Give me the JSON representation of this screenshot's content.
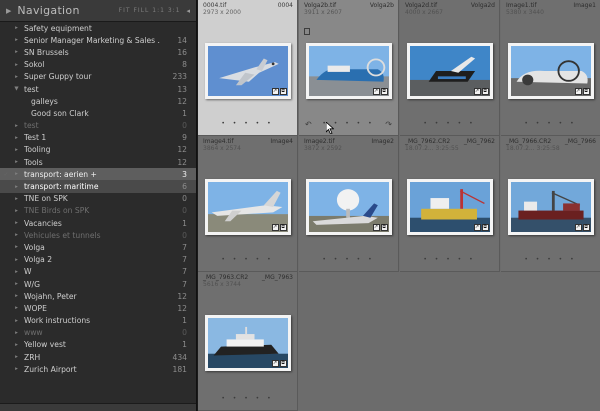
{
  "navigator": {
    "title": "Navigation",
    "options": "FIT  FILL  1:1  3:1"
  },
  "collections": [
    {
      "name": "Safety equipment",
      "count": "",
      "type": "top",
      "check": "",
      "dim": false
    },
    {
      "name": "Senior Manager Marketing & Sales ...",
      "count": "14",
      "type": "top",
      "check": "",
      "dim": false
    },
    {
      "name": "SN Brussels",
      "count": "16",
      "type": "top",
      "check": "",
      "dim": false
    },
    {
      "name": "Sokol",
      "count": "8",
      "type": "top",
      "check": "",
      "dim": false
    },
    {
      "name": "Super Guppy tour",
      "count": "233",
      "type": "top",
      "check": "",
      "dim": false
    },
    {
      "name": "test",
      "count": "13",
      "type": "expanded",
      "check": "",
      "dim": false
    },
    {
      "name": "galleys",
      "count": "12",
      "type": "child",
      "check": "",
      "dim": false
    },
    {
      "name": "Good son Clark",
      "count": "1",
      "type": "child",
      "check": "",
      "dim": false
    },
    {
      "name": "test",
      "count": "0",
      "type": "top",
      "check": "",
      "dim": true
    },
    {
      "name": "Test 1",
      "count": "9",
      "type": "top",
      "check": "",
      "dim": false
    },
    {
      "name": "Tooling",
      "count": "12",
      "type": "top",
      "check": "",
      "dim": false
    },
    {
      "name": "Tools",
      "count": "12",
      "type": "top",
      "check": "",
      "dim": false
    },
    {
      "name": "transport: aerien +",
      "count": "3",
      "type": "top",
      "check": "✓",
      "dim": false,
      "state": "selected"
    },
    {
      "name": "transport: maritime",
      "count": "6",
      "type": "top",
      "check": "",
      "dim": false,
      "state": "highlight"
    },
    {
      "name": "TNE on SPK",
      "count": "0",
      "type": "top",
      "check": "",
      "dim": false
    },
    {
      "name": "TNE Birds on SPK",
      "count": "0",
      "type": "top",
      "check": "",
      "dim": true
    },
    {
      "name": "Vacancies",
      "count": "1",
      "type": "top",
      "check": "",
      "dim": false
    },
    {
      "name": "Vehicules et tunnels",
      "count": "0",
      "type": "top",
      "check": "",
      "dim": true
    },
    {
      "name": "Volga",
      "count": "7",
      "type": "top",
      "check": "",
      "dim": false
    },
    {
      "name": "Volga 2",
      "count": "7",
      "type": "top",
      "check": "",
      "dim": false
    },
    {
      "name": "W",
      "count": "7",
      "type": "top",
      "check": "",
      "dim": false
    },
    {
      "name": "W/G",
      "count": "7",
      "type": "top",
      "check": "",
      "dim": false
    },
    {
      "name": "Wojahn, Peter",
      "count": "12",
      "type": "top",
      "check": "",
      "dim": false
    },
    {
      "name": "WOPE",
      "count": "12",
      "type": "top",
      "check": "",
      "dim": false
    },
    {
      "name": "Work instructions",
      "count": "1",
      "type": "top",
      "check": "",
      "dim": false
    },
    {
      "name": "www",
      "count": "0",
      "type": "top",
      "check": "",
      "dim": true
    },
    {
      "name": "Yellow vest",
      "count": "1",
      "type": "top",
      "check": "",
      "dim": false
    },
    {
      "name": "ZRH",
      "count": "434",
      "type": "top",
      "check": "",
      "dim": false
    },
    {
      "name": "Zurich Airport",
      "count": "181",
      "type": "top",
      "check": "",
      "dim": false
    }
  ],
  "cells": [
    {
      "name": "0004.tif",
      "tag": "0004",
      "dims": "2973 x 2000",
      "scene": "jet",
      "state": "selected"
    },
    {
      "name": "Volga2b.tif",
      "tag": "Volga2b",
      "dims": "3911 x 2607",
      "scene": "hovercraft-a",
      "state": "hover"
    },
    {
      "name": "Volga2d.tif",
      "tag": "Volga2d",
      "dims": "4000 x 2667",
      "scene": "hovercraft-b",
      "state": "normal"
    },
    {
      "name": "Image1.tif",
      "tag": "Image1",
      "dims": "5380 x 3440",
      "scene": "hovercraft-c",
      "state": "normal"
    },
    {
      "name": "Image4.tif",
      "tag": "Image4",
      "dims": "3864 x 2574",
      "scene": "airshow-a",
      "state": "normal"
    },
    {
      "name": "Image2.tif",
      "tag": "Image2",
      "dims": "3872 x 2592",
      "scene": "airshow-b",
      "state": "normal"
    },
    {
      "name": "_MG_7962.CR2",
      "tag": "_MG_7962",
      "dims": "18.07.2... 3:25:55",
      "scene": "ship-a",
      "state": "normal"
    },
    {
      "name": "_MG_7966.CR2",
      "tag": "_MG_7966",
      "dims": "18.07.2... 3:25:58",
      "scene": "ship-b",
      "state": "normal"
    },
    {
      "name": "_MG_7963.CR2",
      "tag": "_MG_7963",
      "dims": "5616 x 3744",
      "scene": "yacht",
      "state": "normal"
    }
  ],
  "icons": {
    "nav_triangle": "triangle-right-icon",
    "check": "checkmark-icon",
    "rotate_left": "rotate-left-icon",
    "rotate_right": "rotate-right-icon",
    "flag": "flag-icon",
    "cursor": "mouse-cursor-icon"
  },
  "badges": {
    "edit": "↗",
    "keyword": "⧉",
    "collection": "▤"
  }
}
